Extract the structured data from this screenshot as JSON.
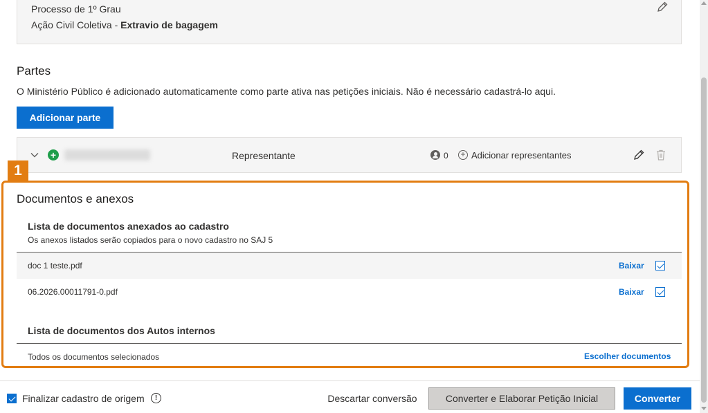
{
  "process": {
    "degree": "Processo de 1º Grau",
    "action_type": "Ação Civil Coletiva - ",
    "action_subject": "Extravio de bagagem"
  },
  "partes": {
    "title": "Partes",
    "note": "O Ministério Público é adicionado automaticamente como parte ativa nas petições iniciais. Não é necessário cadastrá-lo aqui.",
    "add_button": "Adicionar parte",
    "rows": [
      {
        "role": "Representante",
        "rep_count": "0",
        "add_reps": "Adicionar representantes"
      }
    ]
  },
  "step_badge": "1",
  "documents": {
    "title": "Documentos e anexos",
    "attached_list_title": "Lista de documentos anexados ao cadastro",
    "attached_list_sub": "Os anexos listados serão copiados para o novo cadastro no SAJ 5",
    "files": [
      {
        "name": "doc 1 teste.pdf",
        "action": "Baixar",
        "checked": true
      },
      {
        "name": "06.2026.00011791-0.pdf",
        "action": "Baixar",
        "checked": true
      }
    ],
    "internal_list_title": "Lista de documentos dos Autos internos",
    "internal_note": "Todos os documentos selecionados",
    "choose_link": "Escolher documentos"
  },
  "footer": {
    "finalize_label": "Finalizar cadastro de origem",
    "info_glyph": "!",
    "discard": "Descartar conversão",
    "convert_petition": "Converter e Elaborar Petição Inicial",
    "convert": "Converter"
  },
  "colors": {
    "primary": "#0b6fcf",
    "highlight": "#e27d12",
    "add_green": "#1e9e4a"
  }
}
